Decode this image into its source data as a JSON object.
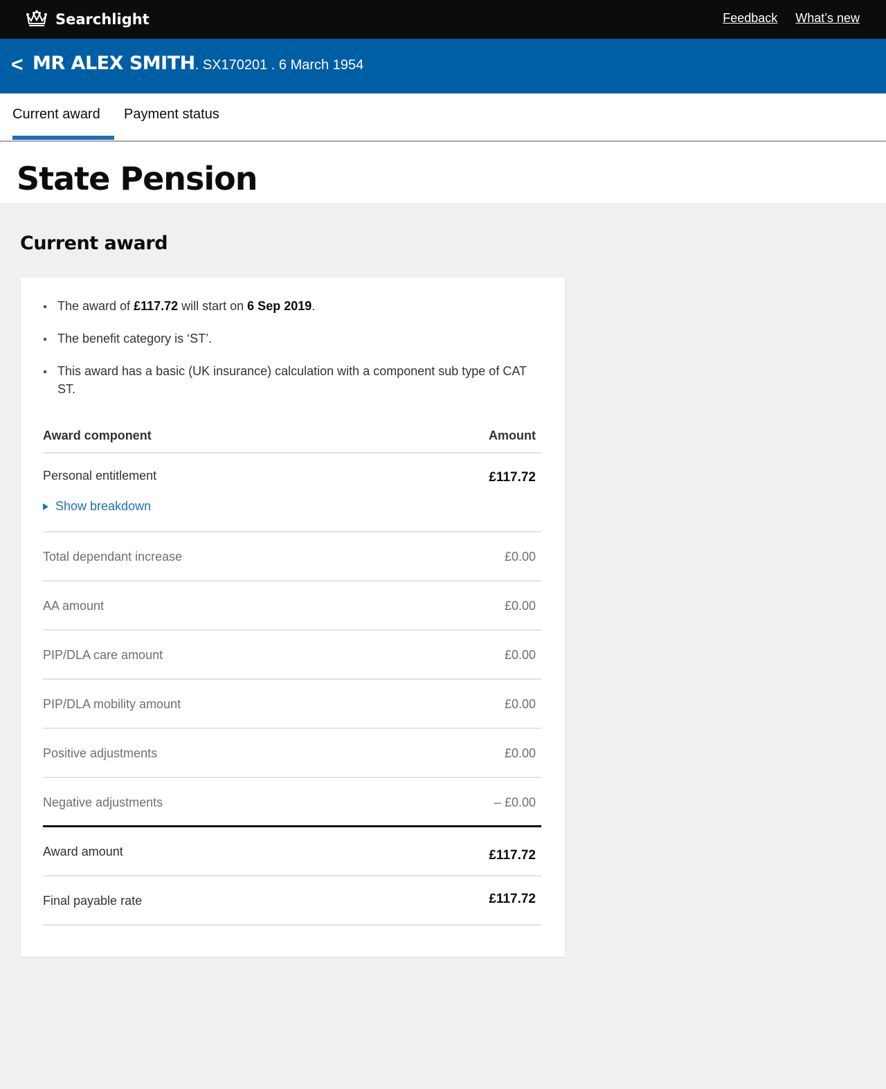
{
  "app": {
    "name": "Searchlight",
    "logo_icon": "crown-icon"
  },
  "toplinks": {
    "feedback": "Feedback",
    "whats_new": "What’s new"
  },
  "person": {
    "back": "<",
    "name": "MR ALEX SMITH",
    "meta": " . SX170201 . 6 March 1954"
  },
  "tabs": [
    {
      "label": "Current award",
      "active": true
    },
    {
      "label": "Payment status",
      "active": false
    }
  ],
  "page_title": "State Pension",
  "section_heading": "Current award",
  "summary": {
    "line1_pre": "The award of ",
    "line1_amount": "£117.72",
    "line1_mid": " will start on ",
    "line1_date": "6 Sep 2019",
    "line1_post": ".",
    "line2": "The benefit category is ‘ST’.",
    "line3": "This award has a basic (UK insurance) calculation with a component sub type of CAT ST."
  },
  "table": {
    "header_component": "Award component",
    "header_amount": "Amount",
    "personal_entitlement": {
      "label": "Personal entitlement",
      "value": "£117.72",
      "breakdown": "Show breakdown"
    },
    "rows": [
      {
        "label": "Total dependant increase",
        "value": "£0.00"
      },
      {
        "label": "AA amount",
        "value": "£0.00"
      },
      {
        "label": "PIP/DLA care amount",
        "value": "£0.00"
      },
      {
        "label": "PIP/DLA mobility amount",
        "value": "£0.00"
      },
      {
        "label": "Positive adjustments",
        "value": "£0.00"
      },
      {
        "label": "Negative adjustments",
        "value": "– £0.00"
      }
    ],
    "award_amount": {
      "label": "Award amount",
      "value": "£117.72"
    },
    "final_payable_rate": {
      "label": "Final payable rate",
      "value": "£117.72"
    }
  }
}
